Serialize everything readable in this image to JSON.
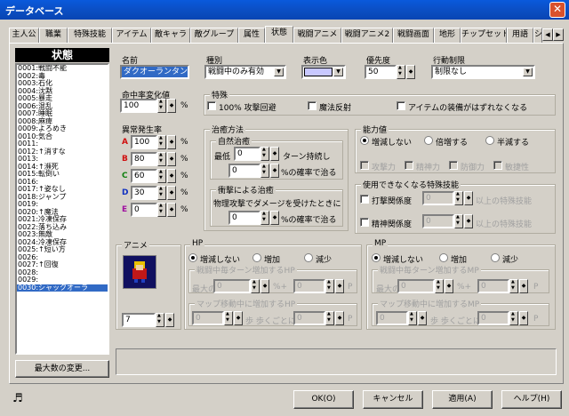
{
  "window": {
    "title": "データベース",
    "close_glyph": "✕"
  },
  "tabs": [
    "主人公",
    "職業",
    "特殊技能",
    "アイテム",
    "敵キャラ",
    "敵グループ",
    "属性",
    "状態",
    "戦闘アニメ",
    "戦闘アニメ2",
    "戦闘画面",
    "地形",
    "チップセット",
    "用語",
    "シス"
  ],
  "selected_tab": "状態",
  "left_panel": {
    "header": "状態",
    "items": [
      "0001:戦闘不能",
      "0002:毒",
      "0003:石化",
      "0004:沈黙",
      "0005:暴走",
      "0006:混乱",
      "0007:睡眠",
      "0008:麻痺",
      "0009:よろめき",
      "0010:気合",
      "0011:",
      "0012:↑消すな",
      "0013:",
      "0014:↑瀕死",
      "0015:転倒い",
      "0016:",
      "0017:↑姿なし",
      "0018:ジャンプ",
      "0019:",
      "0020:↑魔法",
      "0021:冷凍保存",
      "0022:落ち込み",
      "0023:無敵",
      "0024:冷凍保存",
      "0025:↑短い方",
      "0026:",
      "0027:↑回復",
      "0028:",
      "0029:",
      "0030:シャックオーラ"
    ],
    "selected_index": 29,
    "max_button": "最大数の変更..."
  },
  "form": {
    "name_label": "名前",
    "name_value": "ダクオーランタン",
    "type_label": "種別",
    "type_value": "戦闘中のみ有効",
    "color_label": "表示色",
    "priority_label": "優先度",
    "priority_value": "50",
    "restrict_label": "行動制限",
    "restrict_value": "制限なし",
    "hit_label": "命中率変化値",
    "hit_value": "100",
    "percent": "%",
    "special_title": "特殊",
    "special_checks": [
      "100% 攻撃回避",
      "魔法反射",
      "アイテムの装備がはずれなくなる"
    ],
    "rate_title": "異常発生率",
    "rates": [
      {
        "letter": "A",
        "color": "#d01010",
        "value": "100"
      },
      {
        "letter": "B",
        "color": "#d01010",
        "value": "80"
      },
      {
        "letter": "C",
        "color": "#108010",
        "value": "60"
      },
      {
        "letter": "D",
        "color": "#1030c0",
        "value": "30"
      },
      {
        "letter": "E",
        "color": "#a010a0",
        "value": "0"
      }
    ],
    "cure_title": "治癒方法",
    "natural_title": "自然治癒",
    "min_label": "最低",
    "min_value": "0",
    "turn_label": "ターン持続し",
    "nat_rate_value": "0",
    "rate_suffix": "%の確率で治る",
    "shock_title": "衝撃による治癒",
    "shock_desc": "物理攻撃でダメージを受けたときに",
    "shock_value": "0",
    "ability_title": "能力値",
    "ability_radios": [
      "増減しない",
      "倍増する",
      "半減する"
    ],
    "ability_checks": [
      "攻撃力",
      "精神力",
      "防御力",
      "敏捷性"
    ],
    "skill_title": "使用できなくなる特殊技能",
    "skill_rows": [
      {
        "label": "打撃関係度",
        "value": "0",
        "suffix": "以上の特殊技能"
      },
      {
        "label": "精神関係度",
        "value": "0",
        "suffix": "以上の特殊技能"
      }
    ],
    "anime_title": "アニメ",
    "anime_value": "7",
    "hp_title": "HP",
    "mp_title": "MP",
    "hp_radios": [
      "増減しない",
      "増加",
      "減少"
    ],
    "mp_radios": [
      "増減しない",
      "増加",
      "減少"
    ],
    "hp_battle_title": "戦闘中毎ターン増加するHP",
    "mp_battle_title": "戦闘中毎ターン増加するMP",
    "max_label": "最大の",
    "max_value": "0",
    "plus_label": "%+",
    "plus_value": "0",
    "unit_hp": "P",
    "unit_mp": "P",
    "hp_map_title": "マップ移動中に増加するHP",
    "mp_map_title": "マップ移動中に増加するMP",
    "step_value": "0",
    "step_label": "歩 歩くごとに",
    "step_amount": "0"
  },
  "buttons": {
    "ok": "OK(O)",
    "cancel": "キャンセル",
    "apply": "適用(A)",
    "help": "ヘルプ(H)"
  },
  "music_icon": "music-note-icon"
}
